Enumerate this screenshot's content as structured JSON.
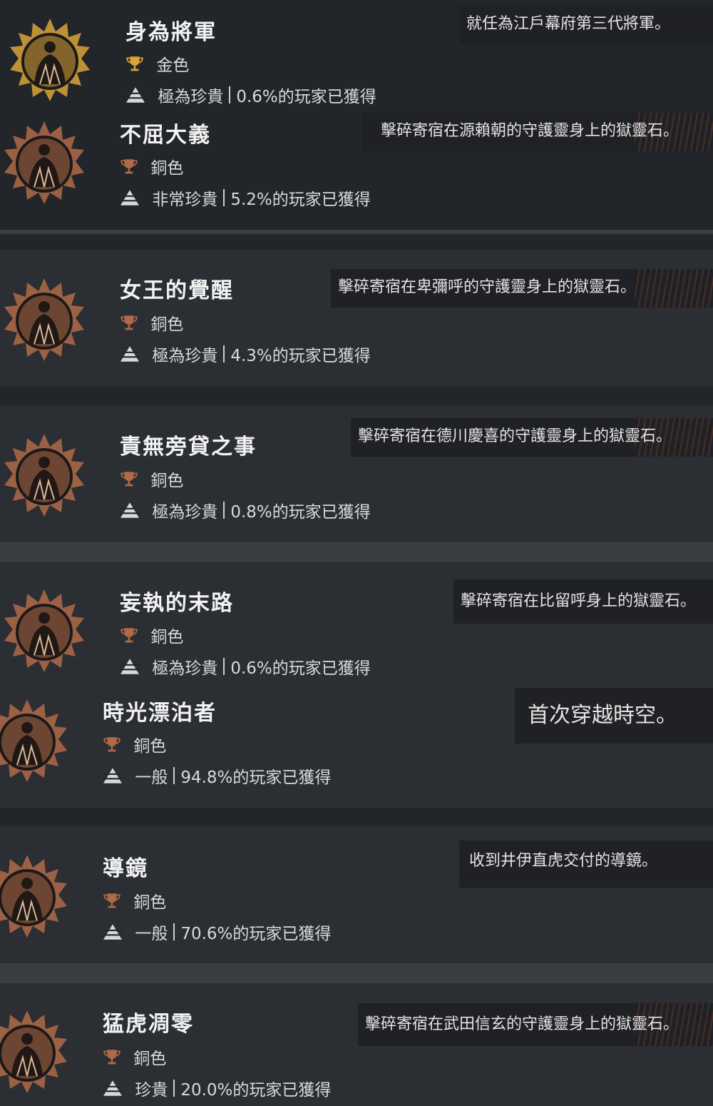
{
  "achievements": [
    {
      "title": "身為將軍",
      "trophy": "金色",
      "rarity": "極為珍貴",
      "earned": "0.6%的玩家已獲得",
      "description": "就任為江戶幕府第三代將軍。",
      "icon": "shogun-emblem-icon"
    },
    {
      "title": "不屈大義",
      "trophy": "銅色",
      "rarity": "非常珍貴",
      "earned": "5.2%的玩家已獲得",
      "description": "擊碎寄宿在源賴朝的守護靈身上的獄靈石。",
      "icon": "warrior-emblem-icon"
    },
    {
      "title": "女王的覺醒",
      "trophy": "銅色",
      "rarity": "極為珍貴",
      "earned": "4.3%的玩家已獲得",
      "description": "擊碎寄宿在卑彌呼的守護靈身上的獄靈石。",
      "icon": "queen-emblem-icon"
    },
    {
      "title": "責無旁貸之事",
      "trophy": "銅色",
      "rarity": "極為珍貴",
      "earned": "0.8%的玩家已獲得",
      "description": "擊碎寄宿在德川慶喜的守護靈身上的獄靈石。",
      "icon": "lord-emblem-icon"
    },
    {
      "title": "妄執的末路",
      "trophy": "銅色",
      "rarity": "極為珍貴",
      "earned": "0.6%的玩家已獲得",
      "description": "擊碎寄宿在比留呼身上的獄靈石。",
      "icon": "demon-emblem-icon"
    },
    {
      "title": "時光漂泊者",
      "trophy": "銅色",
      "rarity": "一般",
      "earned": "94.8%的玩家已獲得",
      "description": "首次穿越時空。",
      "icon": "spirit-emblem-icon"
    },
    {
      "title": "導鏡",
      "trophy": "銅色",
      "rarity": "一般",
      "earned": "70.6%的玩家已獲得",
      "description": "收到井伊直虎交付的導鏡。",
      "icon": "mirror-emblem-icon"
    },
    {
      "title": "猛虎凋零",
      "trophy": "銅色",
      "rarity": "珍貴",
      "earned": "20.0%的玩家已獲得",
      "description": "擊碎寄宿在武田信玄的守護靈身上的獄靈石。",
      "icon": "tiger-emblem-icon"
    }
  ],
  "colors": {
    "gold": "#d9a43a",
    "bronze": "#b06a48",
    "background": "#24272b"
  }
}
